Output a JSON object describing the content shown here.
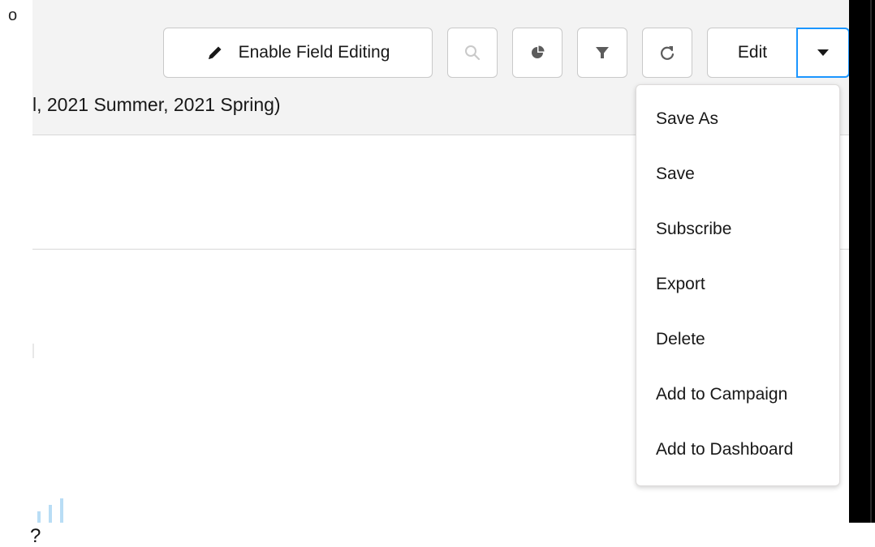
{
  "stray": {
    "bullet": "o",
    "question": "?"
  },
  "report": {
    "subtitle": "l, 2021 Summer, 2021 Spring)"
  },
  "toolbar": {
    "enable_field_editing_label": "Enable Field Editing",
    "edit_label": "Edit",
    "icons": [
      "pencil-icon",
      "search-icon",
      "chart-icon",
      "filter-icon",
      "refresh-icon",
      "chevron-down-icon"
    ]
  },
  "dropdown": {
    "items": [
      {
        "label": "Save As"
      },
      {
        "label": "Save"
      },
      {
        "label": "Subscribe"
      },
      {
        "label": "Export"
      },
      {
        "label": "Delete"
      },
      {
        "label": "Add to Campaign"
      },
      {
        "label": "Add to Dashboard"
      }
    ]
  },
  "colors": {
    "accent": "#1b96ff",
    "icon_gray": "#c9c9c9",
    "icon_dark": "#5c5c5c",
    "header_bg": "#f3f3f3",
    "mini_bar": "#b9ddf5"
  }
}
